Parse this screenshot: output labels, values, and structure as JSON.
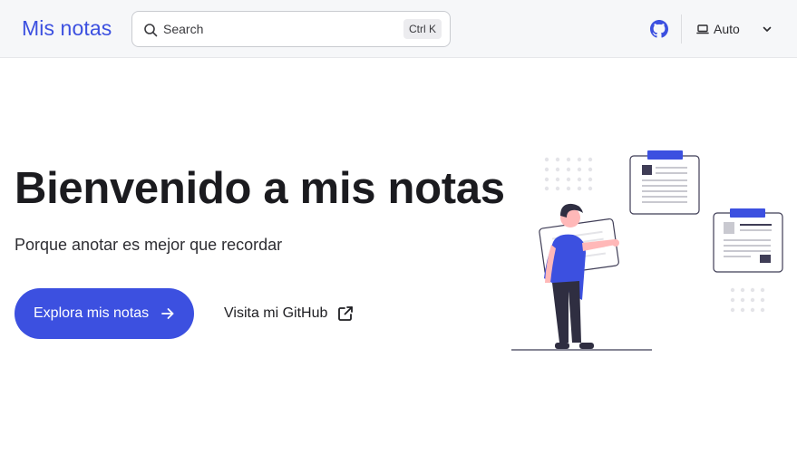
{
  "header": {
    "brand": "Mis notas",
    "search": {
      "placeholder": "Search",
      "shortcut": "Ctrl K"
    },
    "theme": {
      "selected": "Auto"
    },
    "icons": [
      "search-icon",
      "github-icon",
      "monitor-icon",
      "chevron-down-icon"
    ]
  },
  "hero": {
    "title": "Bienvenido a mis notas",
    "tagline": "Porque anotar es mejor que recordar",
    "primary_cta": "Explora mis notas",
    "secondary_cta": "Visita mi GitHub"
  },
  "colors": {
    "accent": "#3c50e0",
    "header_bg": "#f6f7f9",
    "text": "#1b1b1f"
  }
}
